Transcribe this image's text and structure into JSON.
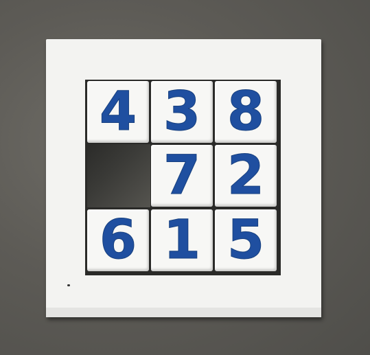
{
  "puzzle": {
    "tiles": [
      {
        "label": "4"
      },
      {
        "label": "3"
      },
      {
        "label": "8"
      },
      {
        "label": ""
      },
      {
        "label": "7"
      },
      {
        "label": "2"
      },
      {
        "label": "6"
      },
      {
        "label": "1"
      },
      {
        "label": "5"
      }
    ],
    "empty_position": {
      "row": 2,
      "col": 1
    },
    "colors": {
      "number": "#1f4fa0",
      "tile": "#f7f7f5",
      "frame": "#f3f3f1",
      "background": "#5d5b56"
    }
  }
}
